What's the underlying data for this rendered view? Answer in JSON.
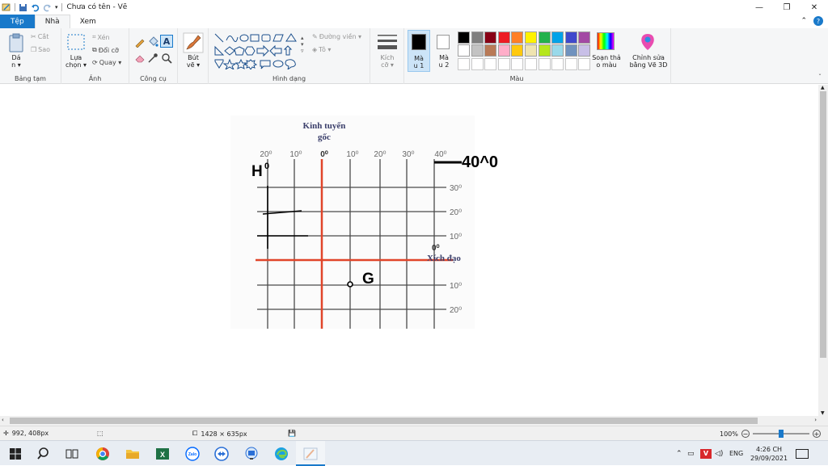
{
  "window": {
    "title": "Chưa có tên - Vẽ",
    "minimize": "—",
    "restore": "❐",
    "close": "✕"
  },
  "tabs": {
    "file": "Tệp",
    "home": "Nhà",
    "view": "Xem"
  },
  "ribbon": {
    "clipboard": {
      "label": "Bảng tạm",
      "paste": "Dá\nn ▾",
      "cut": "Cắt",
      "copy": "Sao"
    },
    "image": {
      "label": "Ảnh",
      "select": "Lựa\nchọn ▾",
      "crop": "Xén",
      "resize": "Đổi cỡ",
      "rotate": "Quay ▾"
    },
    "tools": {
      "label": "Công cụ"
    },
    "brushes": {
      "label": "Bút\nvẽ ▾"
    },
    "shapes": {
      "label": "Hình dạng",
      "outline": "Đường viền ▾",
      "fill": "Tô ▾"
    },
    "size": {
      "label": "Kích\ncỡ ▾"
    },
    "color1": {
      "label": "Mà\nu 1"
    },
    "color2": {
      "label": "Mà\nu 2"
    },
    "colors": {
      "label": "Màu",
      "row1": [
        "#000000",
        "#7f7f7f",
        "#880015",
        "#ed1c24",
        "#ff7f27",
        "#fff200",
        "#22b14c",
        "#00a2e8",
        "#3f48cc",
        "#a349a4"
      ],
      "row2": [
        "#ffffff",
        "#c3c3c3",
        "#b97a57",
        "#ffaec9",
        "#ffc90e",
        "#efe4b0",
        "#b5e61d",
        "#99d9ea",
        "#7092be",
        "#c8bfe7"
      ]
    },
    "edit_colors": {
      "label": "Soạn thả\no màu"
    },
    "paint3d": {
      "label": "Chỉnh sửa\nbằng Vẽ 3D"
    }
  },
  "drawing": {
    "meridian_title_1": "Kinh tuyến",
    "meridian_title_2": "gốc",
    "top_ticks": [
      "20⁰",
      "10⁰",
      "0⁰",
      "10⁰",
      "20⁰",
      "30⁰",
      "40⁰"
    ],
    "right_ticks": [
      "30⁰",
      "20⁰",
      "10⁰",
      "0⁰",
      "10⁰",
      "20⁰"
    ],
    "equator_label": "Xích đạo",
    "label_h": "H",
    "label_h_sup": "0",
    "label_g": "G",
    "label_40": "40^0"
  },
  "status": {
    "cursor": "992, 408px",
    "canvas_size": "1428 × 635px",
    "zoom": "100%",
    "zoom_level": 0.5
  },
  "taskbar": {
    "language": "ENG",
    "time": "4:26 CH",
    "date": "29/09/2021"
  },
  "colors": {
    "accent": "#1979ca",
    "red_line": "#e0452a",
    "grid": "#444444"
  }
}
